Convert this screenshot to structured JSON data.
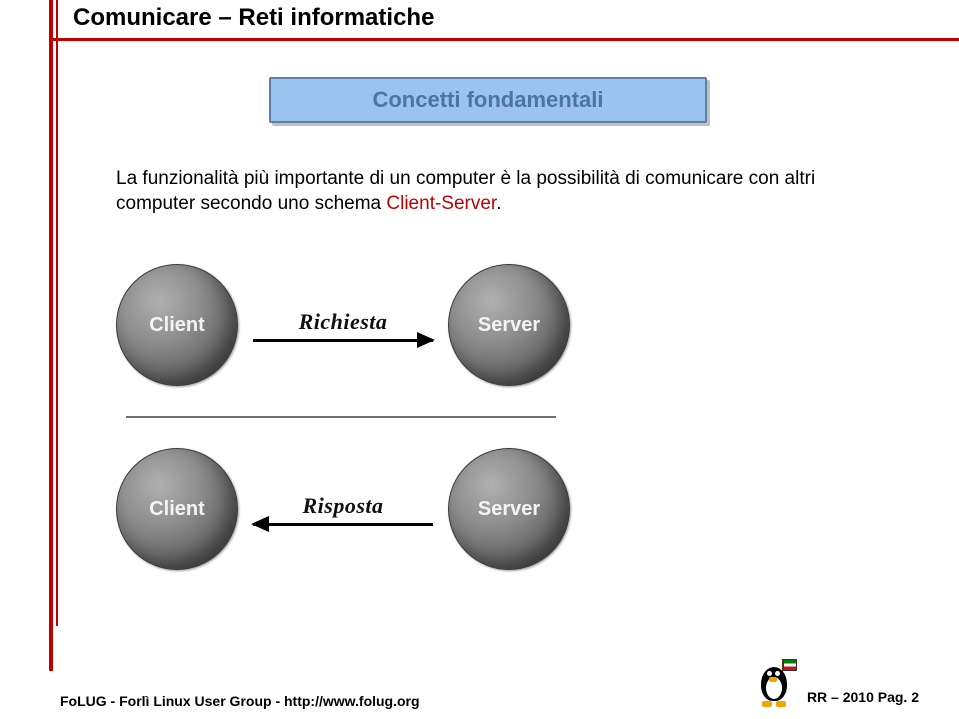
{
  "header": {
    "title": "Comunicare – Reti informatiche",
    "subtitle": "Concetti fondamentali"
  },
  "body": {
    "part1": "La funzionalità più importante di un computer è la possibilità di comunicare con altri computer secondo uno schema ",
    "highlight": "Client-Server",
    "part2": "."
  },
  "diagram": {
    "row1": {
      "left": "Client",
      "label": "Richiesta",
      "right": "Server",
      "direction": "right"
    },
    "row2": {
      "left": "Client",
      "label": "Risposta",
      "right": "Server",
      "direction": "left"
    }
  },
  "footer": {
    "left": "FoLUG - Forlì Linux User Group - http://www.folug.org",
    "right": "RR – 2010  Pag. 2"
  }
}
